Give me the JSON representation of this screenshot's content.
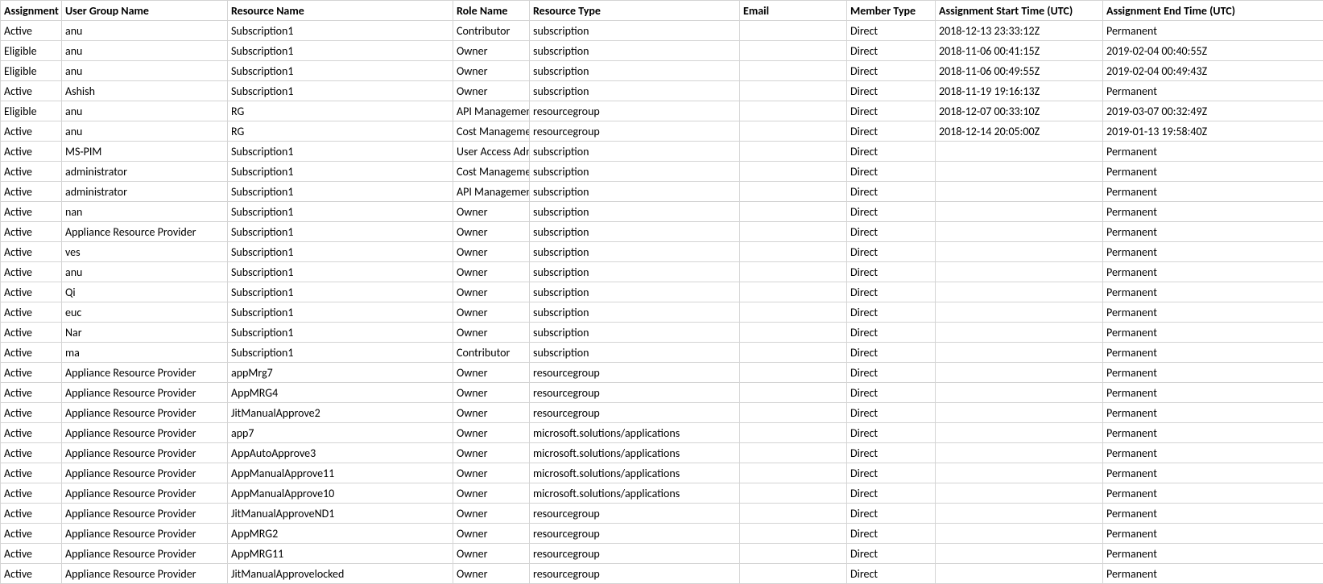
{
  "columns": [
    "Assignment",
    "User Group Name",
    "Resource Name",
    "Role Name",
    "Resource Type",
    "Email",
    "Member Type",
    "Assignment Start Time (UTC)",
    "Assignment End Time (UTC)"
  ],
  "rows": [
    {
      "state": "Active",
      "user": "anu",
      "resource": "Subscription1",
      "role": "Contributor",
      "type": "subscription",
      "email": "",
      "member": "Direct",
      "start": "2018-12-13 23:33:12Z",
      "end": "Permanent"
    },
    {
      "state": "Eligible",
      "user": "anu",
      "resource": "Subscription1",
      "role": "Owner",
      "type": "subscription",
      "email": "",
      "member": "Direct",
      "start": "2018-11-06 00:41:15Z",
      "end": "2019-02-04 00:40:55Z"
    },
    {
      "state": "Eligible",
      "user": "anu",
      "resource": "Subscription1",
      "role": "Owner",
      "type": "subscription",
      "email": "",
      "member": "Direct",
      "start": "2018-11-06 00:49:55Z",
      "end": "2019-02-04 00:49:43Z"
    },
    {
      "state": "Active",
      "user": "Ashish",
      "resource": "Subscription1",
      "role": "Owner",
      "type": "subscription",
      "email": "",
      "member": "Direct",
      "start": "2018-11-19 19:16:13Z",
      "end": "Permanent"
    },
    {
      "state": "Eligible",
      "user": "anu",
      "resource": "RG",
      "role": "API Management",
      "type": "resourcegroup",
      "email": "",
      "member": "Direct",
      "start": "2018-12-07 00:33:10Z",
      "end": "2019-03-07 00:32:49Z"
    },
    {
      "state": "Active",
      "user": "anu",
      "resource": "RG",
      "role": "Cost Management",
      "type": "resourcegroup",
      "email": "",
      "member": "Direct",
      "start": "2018-12-14 20:05:00Z",
      "end": "2019-01-13 19:58:40Z"
    },
    {
      "state": "Active",
      "user": "MS-PIM",
      "resource": "Subscription1",
      "role": "User Access Administrator",
      "type": "subscription",
      "email": "",
      "member": "Direct",
      "start": "",
      "end": "Permanent"
    },
    {
      "state": "Active",
      "user": "administrator",
      "resource": "Subscription1",
      "role": "Cost Management",
      "type": "subscription",
      "email": "",
      "member": "Direct",
      "start": "",
      "end": "Permanent"
    },
    {
      "state": "Active",
      "user": "administrator",
      "resource": "Subscription1",
      "role": "API Management",
      "type": "subscription",
      "email": "",
      "member": "Direct",
      "start": "",
      "end": "Permanent"
    },
    {
      "state": "Active",
      "user": "nan",
      "resource": "Subscription1",
      "role": "Owner",
      "type": "subscription",
      "email": "",
      "member": "Direct",
      "start": "",
      "end": "Permanent"
    },
    {
      "state": "Active",
      "user": "Appliance Resource Provider",
      "resource": "Subscription1",
      "role": "Owner",
      "type": "subscription",
      "email": "",
      "member": "Direct",
      "start": "",
      "end": "Permanent"
    },
    {
      "state": "Active",
      "user": "ves",
      "resource": "Subscription1",
      "role": "Owner",
      "type": "subscription",
      "email": "",
      "member": "Direct",
      "start": "",
      "end": "Permanent"
    },
    {
      "state": "Active",
      "user": "anu",
      "resource": "Subscription1",
      "role": "Owner",
      "type": "subscription",
      "email": "",
      "member": "Direct",
      "start": "",
      "end": "Permanent"
    },
    {
      "state": "Active",
      "user": "Qi",
      "resource": "Subscription1",
      "role": "Owner",
      "type": "subscription",
      "email": "",
      "member": "Direct",
      "start": "",
      "end": "Permanent"
    },
    {
      "state": "Active",
      "user": "euc",
      "resource": "Subscription1",
      "role": "Owner",
      "type": "subscription",
      "email": "",
      "member": "Direct",
      "start": "",
      "end": "Permanent"
    },
    {
      "state": "Active",
      "user": "Nar",
      "resource": "Subscription1",
      "role": "Owner",
      "type": "subscription",
      "email": "",
      "member": "Direct",
      "start": "",
      "end": "Permanent"
    },
    {
      "state": "Active",
      "user": "ma",
      "resource": "Subscription1",
      "role": "Contributor",
      "type": "subscription",
      "email": "",
      "member": "Direct",
      "start": "",
      "end": "Permanent"
    },
    {
      "state": "Active",
      "user": "Appliance Resource Provider",
      "resource": "appMrg7",
      "role": "Owner",
      "type": "resourcegroup",
      "email": "",
      "member": "Direct",
      "start": "",
      "end": "Permanent"
    },
    {
      "state": "Active",
      "user": "Appliance Resource Provider",
      "resource": "AppMRG4",
      "role": "Owner",
      "type": "resourcegroup",
      "email": "",
      "member": "Direct",
      "start": "",
      "end": "Permanent"
    },
    {
      "state": "Active",
      "user": "Appliance Resource Provider",
      "resource": "JitManualApprove2",
      "role": "Owner",
      "type": "resourcegroup",
      "email": "",
      "member": "Direct",
      "start": "",
      "end": "Permanent"
    },
    {
      "state": "Active",
      "user": "Appliance Resource Provider",
      "resource": "app7",
      "role": "Owner",
      "type": "microsoft.solutions/applications",
      "email": "",
      "member": "Direct",
      "start": "",
      "end": "Permanent"
    },
    {
      "state": "Active",
      "user": "Appliance Resource Provider",
      "resource": "AppAutoApprove3",
      "role": "Owner",
      "type": "microsoft.solutions/applications",
      "email": "",
      "member": "Direct",
      "start": "",
      "end": "Permanent"
    },
    {
      "state": "Active",
      "user": "Appliance Resource Provider",
      "resource": "AppManualApprove11",
      "role": "Owner",
      "type": "microsoft.solutions/applications",
      "email": "",
      "member": "Direct",
      "start": "",
      "end": "Permanent"
    },
    {
      "state": "Active",
      "user": "Appliance Resource Provider",
      "resource": "AppManualApprove10",
      "role": "Owner",
      "type": "microsoft.solutions/applications",
      "email": "",
      "member": "Direct",
      "start": "",
      "end": "Permanent"
    },
    {
      "state": "Active",
      "user": "Appliance Resource Provider",
      "resource": "JitManualApproveND1",
      "role": "Owner",
      "type": "resourcegroup",
      "email": "",
      "member": "Direct",
      "start": "",
      "end": "Permanent"
    },
    {
      "state": "Active",
      "user": "Appliance Resource Provider",
      "resource": "AppMRG2",
      "role": "Owner",
      "type": "resourcegroup",
      "email": "",
      "member": "Direct",
      "start": "",
      "end": "Permanent"
    },
    {
      "state": "Active",
      "user": "Appliance Resource Provider",
      "resource": "AppMRG11",
      "role": "Owner",
      "type": "resourcegroup",
      "email": "",
      "member": "Direct",
      "start": "",
      "end": "Permanent"
    },
    {
      "state": "Active",
      "user": "Appliance Resource Provider",
      "resource": "JitManualApprovelocked",
      "role": "Owner",
      "type": "resourcegroup",
      "email": "",
      "member": "Direct",
      "start": "",
      "end": "Permanent"
    }
  ]
}
